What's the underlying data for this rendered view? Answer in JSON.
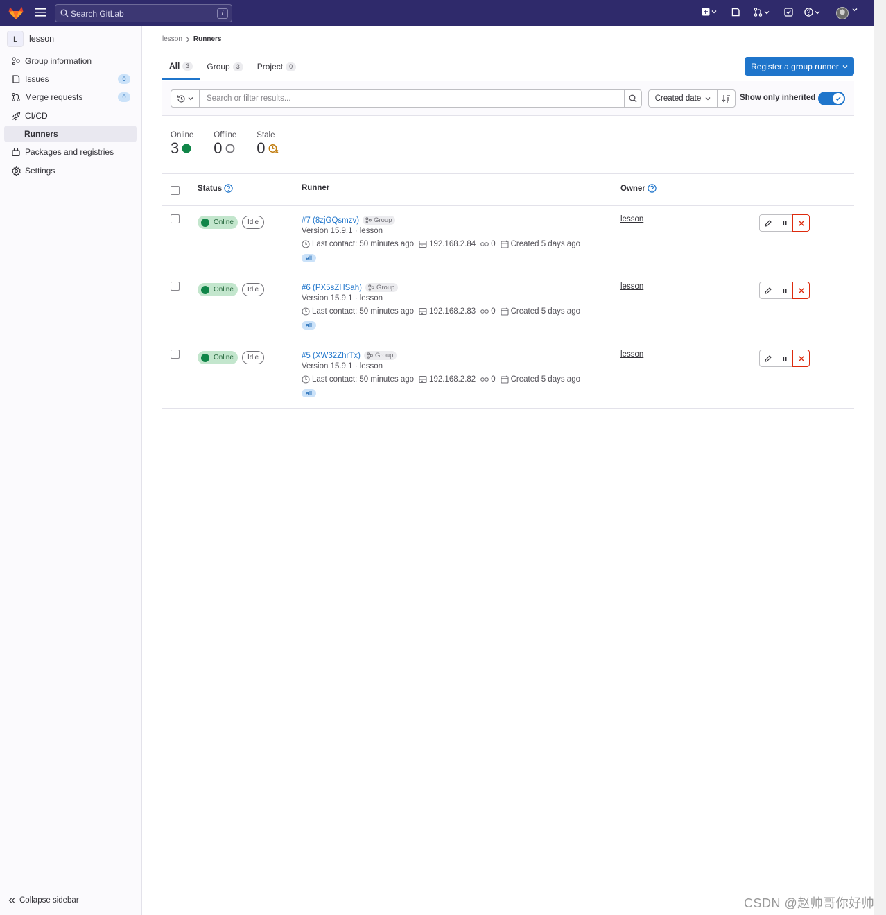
{
  "topbar": {
    "search_placeholder": "Search GitLab",
    "search_shortcut": "/"
  },
  "sidebar": {
    "context_initial": "L",
    "context_name": "lesson",
    "items": [
      {
        "label": "Group information",
        "icon": "group-icon"
      },
      {
        "label": "Issues",
        "icon": "issues-icon",
        "count": "0"
      },
      {
        "label": "Merge requests",
        "icon": "merge-request-icon",
        "count": "0"
      },
      {
        "label": "CI/CD",
        "icon": "rocket-icon"
      },
      {
        "label": "Runners",
        "active": true
      },
      {
        "label": "Packages and registries",
        "icon": "package-icon"
      },
      {
        "label": "Settings",
        "icon": "settings-icon"
      }
    ],
    "collapse_label": "Collapse sidebar"
  },
  "breadcrumb": {
    "parent": "lesson",
    "current": "Runners"
  },
  "tabs": [
    {
      "label": "All",
      "count": "3",
      "active": true
    },
    {
      "label": "Group",
      "count": "3"
    },
    {
      "label": "Project",
      "count": "0"
    }
  ],
  "register_button": "Register a group runner",
  "filter": {
    "placeholder": "Search or filter results...",
    "sort_label": "Created date",
    "inherited_label": "Show only inherited",
    "inherited_on": true
  },
  "stats": [
    {
      "label": "Online",
      "value": "3",
      "status": "online"
    },
    {
      "label": "Offline",
      "value": "0",
      "status": "offline"
    },
    {
      "label": "Stale",
      "value": "0",
      "status": "stale"
    }
  ],
  "table": {
    "headers": {
      "status": "Status",
      "runner": "Runner",
      "owner": "Owner"
    }
  },
  "runners": [
    {
      "status": "Online",
      "state": "Idle",
      "name": "#7 (8zjGQsmzv)",
      "type": "Group",
      "version": "Version 15.9.1 · lesson",
      "last_contact": "Last contact: 50 minutes ago",
      "ip": "192.168.2.84",
      "jobs": "0",
      "created": "Created 5 days ago",
      "tag": "all",
      "owner": "lesson"
    },
    {
      "status": "Online",
      "state": "Idle",
      "name": "#6 (PX5sZHSah)",
      "type": "Group",
      "version": "Version 15.9.1 · lesson",
      "last_contact": "Last contact: 50 minutes ago",
      "ip": "192.168.2.83",
      "jobs": "0",
      "created": "Created 5 days ago",
      "tag": "all",
      "owner": "lesson"
    },
    {
      "status": "Online",
      "state": "Idle",
      "name": "#5 (XW32ZhrTx)",
      "type": "Group",
      "version": "Version 15.9.1 · lesson",
      "last_contact": "Last contact: 50 minutes ago",
      "ip": "192.168.2.82",
      "jobs": "0",
      "created": "Created 5 days ago",
      "tag": "all",
      "owner": "lesson"
    }
  ],
  "watermark": "CSDN @赵帅哥你好帅",
  "colors": {
    "topbar": "#2f2a6b",
    "primary": "#1f75cb",
    "online": "#108548",
    "danger": "#dd2b0e"
  }
}
